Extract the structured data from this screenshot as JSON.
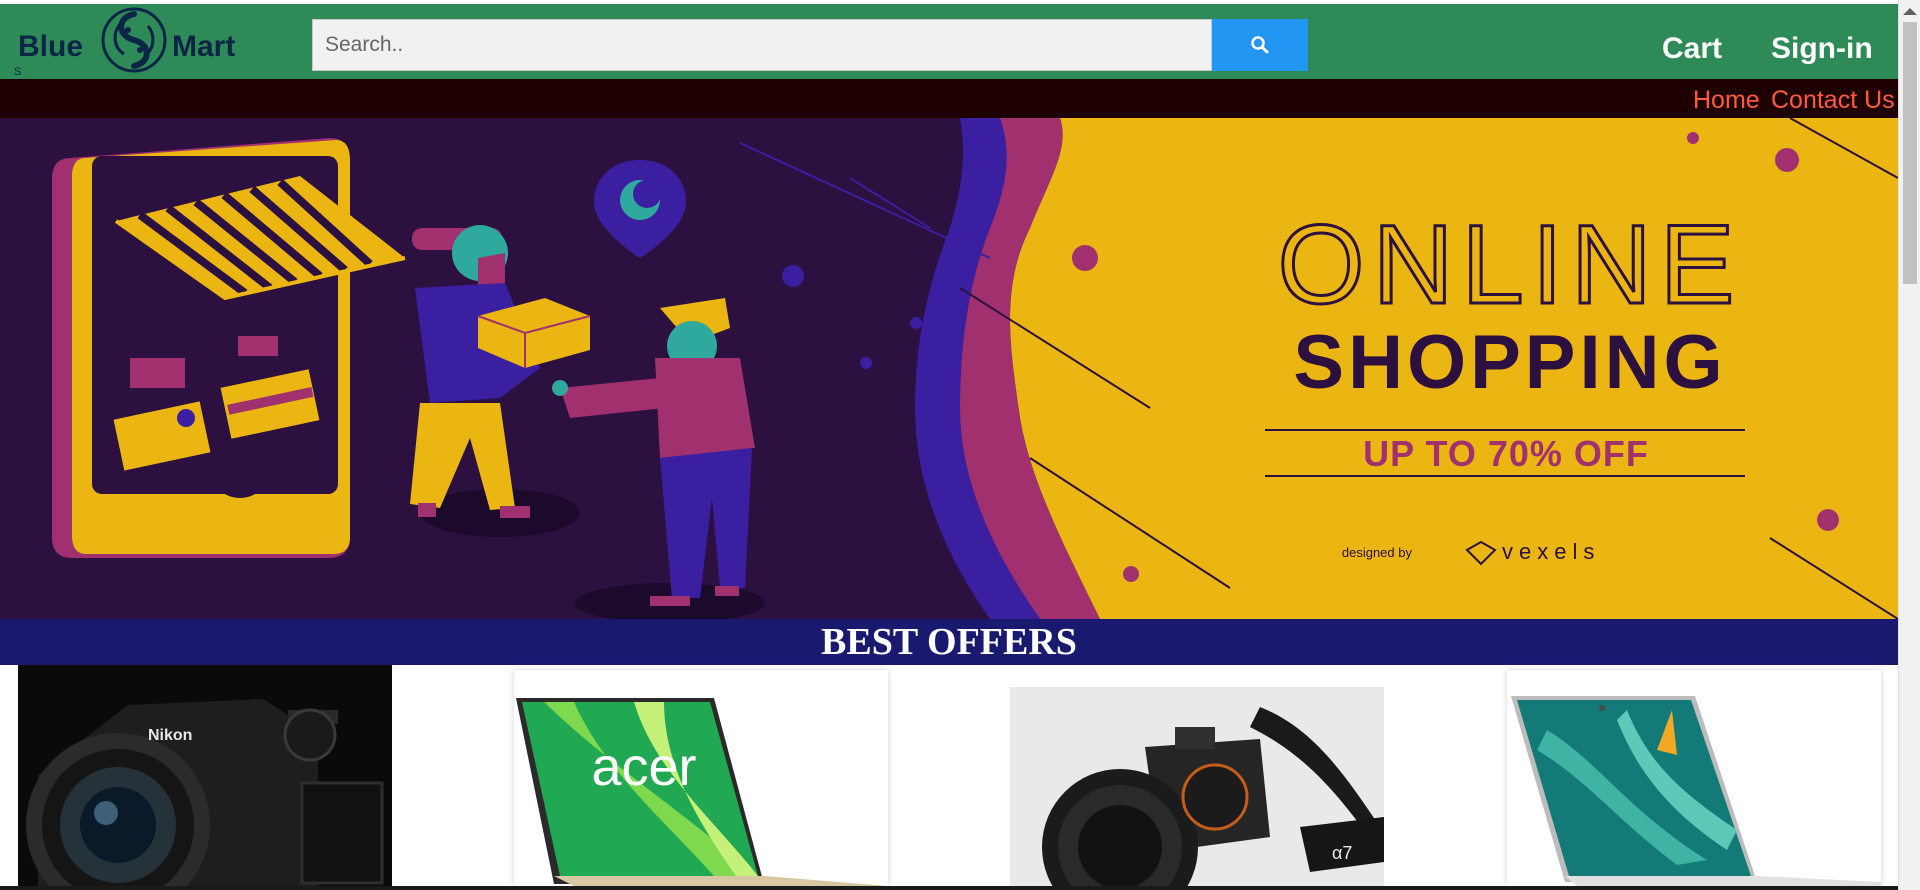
{
  "logo": {
    "left_word": "Blue",
    "right_word": "Mart",
    "small_mark": "S"
  },
  "search": {
    "placeholder": "Search..",
    "value": "",
    "button_icon": "search-icon"
  },
  "header": {
    "cart": "Cart",
    "signin": "Sign-in"
  },
  "nav": {
    "home": "Home",
    "contact": "Contact Us"
  },
  "banner": {
    "headline_1": "ONLINE",
    "headline_2": "SHOPPING",
    "offer": "UP TO 70% OFF",
    "credit_prefix": "designed by",
    "credit_brand": "vexels"
  },
  "offers": {
    "title": "BEST OFFERS",
    "products": [
      {
        "image": "Nikon D500 DSLR camera",
        "brand_text": "Nikon"
      },
      {
        "image": "Acer laptop",
        "brand_text": "acer"
      },
      {
        "image": "Sony alpha camera with strap",
        "brand_text": "α7"
      },
      {
        "image": "HP laptop",
        "brand_text": ""
      }
    ]
  },
  "colors": {
    "header_bg": "#2e8b57",
    "nav_bg": "#1e0000",
    "nav_link": "#ff5a3c",
    "search_button": "#2196f3",
    "offers_bg": "#191970",
    "banner_purple": "#2b1040",
    "banner_yellow": "#ecb612",
    "banner_magenta": "#a0306e"
  }
}
